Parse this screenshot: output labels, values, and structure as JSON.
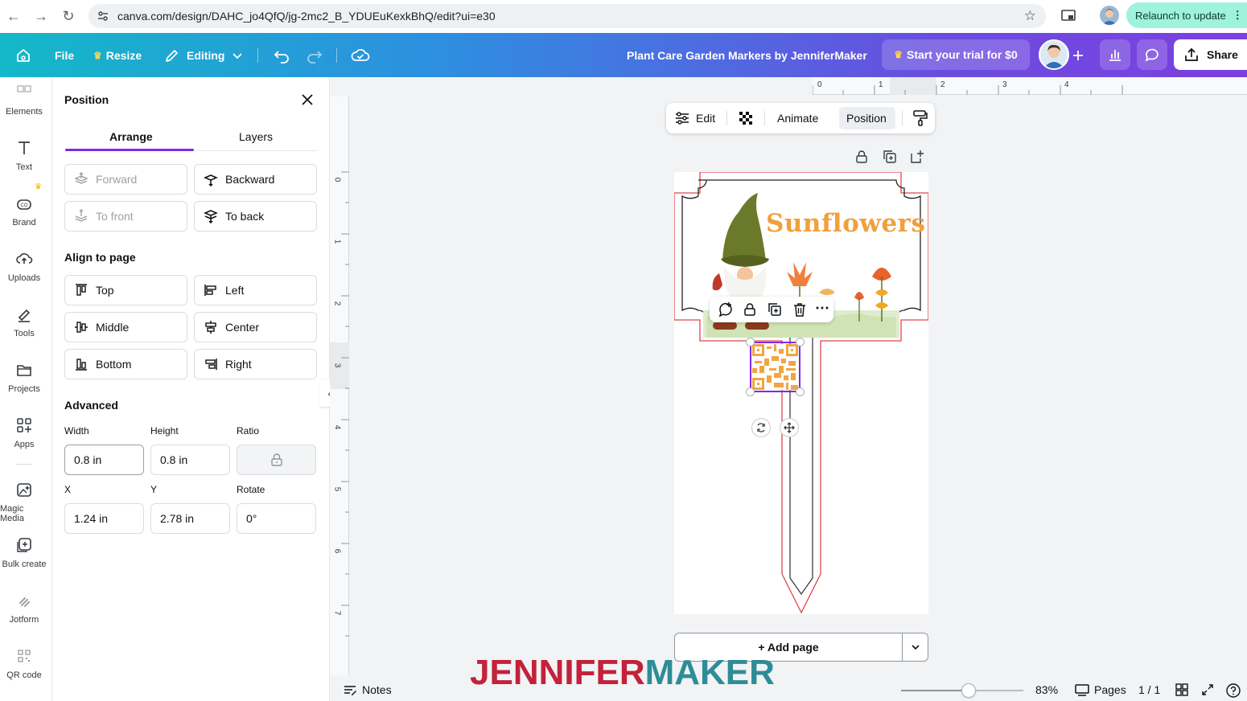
{
  "browser": {
    "url": "canva.com/design/DAHC_jo4QfQ/jg-2mc2_B_YDUEuKexkBhQ/edit?ui=e30",
    "relaunch_label": "Relaunch to update"
  },
  "header": {
    "file_label": "File",
    "resize_label": "Resize",
    "editing_label": "Editing",
    "design_title": "Plant Care Garden Markers by JenniferMaker",
    "trial_label": "Start your trial for $0",
    "share_label": "Share",
    "colors": {
      "gradient_start": "#14b8c8",
      "gradient_end": "#7c3fe0",
      "crown": "#ffd44d"
    }
  },
  "rail": {
    "items": [
      {
        "label": "Elements",
        "icon": "elements-icon"
      },
      {
        "label": "Text",
        "icon": "text-icon"
      },
      {
        "label": "Brand",
        "icon": "brand-icon"
      },
      {
        "label": "Uploads",
        "icon": "uploads-icon"
      },
      {
        "label": "Tools",
        "icon": "tools-icon"
      },
      {
        "label": "Projects",
        "icon": "projects-icon"
      },
      {
        "label": "Apps",
        "icon": "apps-icon"
      },
      {
        "label": "Magic Media",
        "icon": "magic-media-icon"
      },
      {
        "label": "Bulk create",
        "icon": "bulk-create-icon"
      },
      {
        "label": "Jotform",
        "icon": "jotform-icon"
      },
      {
        "label": "QR code",
        "icon": "qr-code-icon"
      }
    ]
  },
  "panel": {
    "title": "Position",
    "tabs": [
      "Arrange",
      "Layers"
    ],
    "arrange": {
      "forward": "Forward",
      "backward": "Backward",
      "to_front": "To front",
      "to_back": "To back"
    },
    "align_title": "Align to page",
    "align": {
      "top": "Top",
      "left": "Left",
      "middle": "Middle",
      "center": "Center",
      "bottom": "Bottom",
      "right": "Right"
    },
    "advanced_title": "Advanced",
    "labels": {
      "width": "Width",
      "height": "Height",
      "ratio": "Ratio",
      "x": "X",
      "y": "Y",
      "rotate": "Rotate"
    },
    "values": {
      "width": "0.8 in",
      "height": "0.8 in",
      "x": "1.24 in",
      "y": "2.78 in",
      "rotate": "0°"
    }
  },
  "rulers": {
    "top": [
      "0",
      "1",
      "2",
      "3",
      "4"
    ],
    "left": [
      "0",
      "1",
      "2",
      "3",
      "4",
      "5",
      "6",
      "7"
    ]
  },
  "context_toolbar": {
    "edit_label": "Edit",
    "animate_label": "Animate",
    "position_label": "Position"
  },
  "design": {
    "marker_title": "Sunflowers",
    "title_color": "#f0a03c",
    "cut_line_color": "#e0454f",
    "selection_color": "#7d2ae8"
  },
  "canvas": {
    "add_page_label": "+ Add page"
  },
  "bottom_bar": {
    "notes_label": "Notes",
    "zoom_level": 0.83,
    "zoom_label": "83%",
    "pages_label": "Pages",
    "page_count": "1 / 1"
  },
  "watermark": {
    "part1": "JENNIFER",
    "part2": "MAKER",
    "color1": "#c4213a",
    "color2": "#2f8c96"
  }
}
